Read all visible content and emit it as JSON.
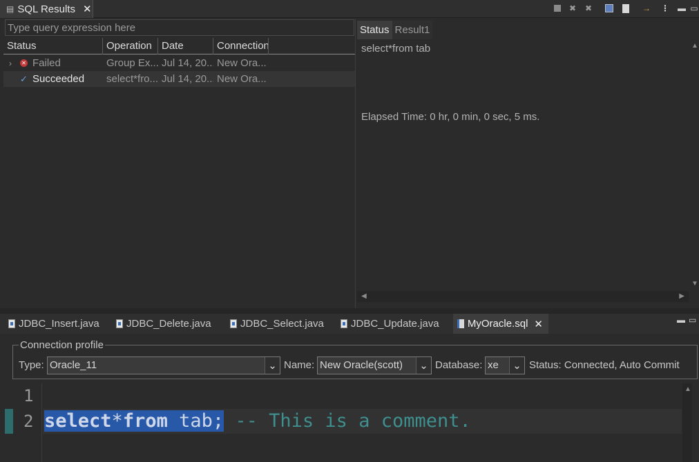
{
  "view_tab": {
    "label": "SQL Results",
    "close": "✕"
  },
  "toolbar_icons": [
    "stop-icon",
    "remove-icon",
    "remove-all-icon",
    "save-icon",
    "copy-icon",
    "export-icon",
    "view-menu-icon",
    "minimize-icon",
    "maximize-icon"
  ],
  "left": {
    "search_placeholder": "Type query expression here",
    "columns": [
      "Status",
      "Operation",
      "Date",
      "Connection"
    ],
    "rows": [
      {
        "status": "Failed",
        "operation": "Group Ex...",
        "date": "Jul 14, 20...",
        "connection": "New Ora..."
      },
      {
        "status": "Succeeded",
        "operation": "select*fro...",
        "date": "Jul 14, 20...",
        "connection": "New Ora..."
      }
    ]
  },
  "right": {
    "tabs": [
      "Status",
      "Result1"
    ],
    "query": "select*from tab",
    "elapsed": "Elapsed Time:  0 hr, 0 min, 0 sec, 5 ms."
  },
  "editor_tabs": [
    "JDBC_Insert.java",
    "JDBC_Delete.java",
    "JDBC_Select.java",
    "JDBC_Update.java",
    "MyOracle.sql"
  ],
  "connection": {
    "legend": "Connection profile",
    "type_label": "Type:",
    "type_value": "Oracle_11",
    "name_label": "Name:",
    "name_value": "New Oracle(scott)",
    "database_label": "Database:",
    "database_value": "xe",
    "status": "Status: Connected, Auto Commit"
  },
  "editor": {
    "line_numbers": [
      "1",
      "2"
    ],
    "kw_select": "select",
    "star": "*",
    "kw_from": "from",
    "rest": " tab;",
    "comment": " -- This is a comment."
  },
  "colors": {
    "selection": "#2859a8",
    "comment": "#3f8f8f",
    "keyword": "#cfd8ea"
  }
}
